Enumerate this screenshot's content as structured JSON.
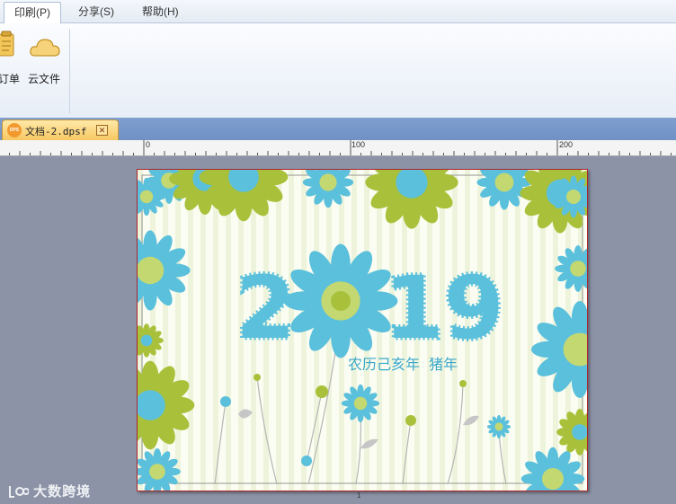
{
  "menu": {
    "items": [
      {
        "label": "印刷(P)",
        "active": true
      },
      {
        "label": "分享(S)",
        "active": false
      },
      {
        "label": "帮助(H)",
        "active": false
      }
    ]
  },
  "ribbon": {
    "buttons": [
      {
        "label": "订单",
        "icon": "order-icon"
      },
      {
        "label": "云文件",
        "icon": "cloud-icon"
      }
    ]
  },
  "document_tab": {
    "icon_text": "DPS",
    "title": "文档-2.dpsf",
    "close": "✕"
  },
  "ruler": {
    "labels": [
      "0",
      "100",
      "200"
    ]
  },
  "page": {
    "year": "2019",
    "subtitle": "农历己亥年  猪年",
    "number": "1"
  },
  "watermark": "大数跨境",
  "colors": {
    "blue": "#5bc0dc",
    "green": "#a9c13a",
    "border": "#b2262b"
  }
}
